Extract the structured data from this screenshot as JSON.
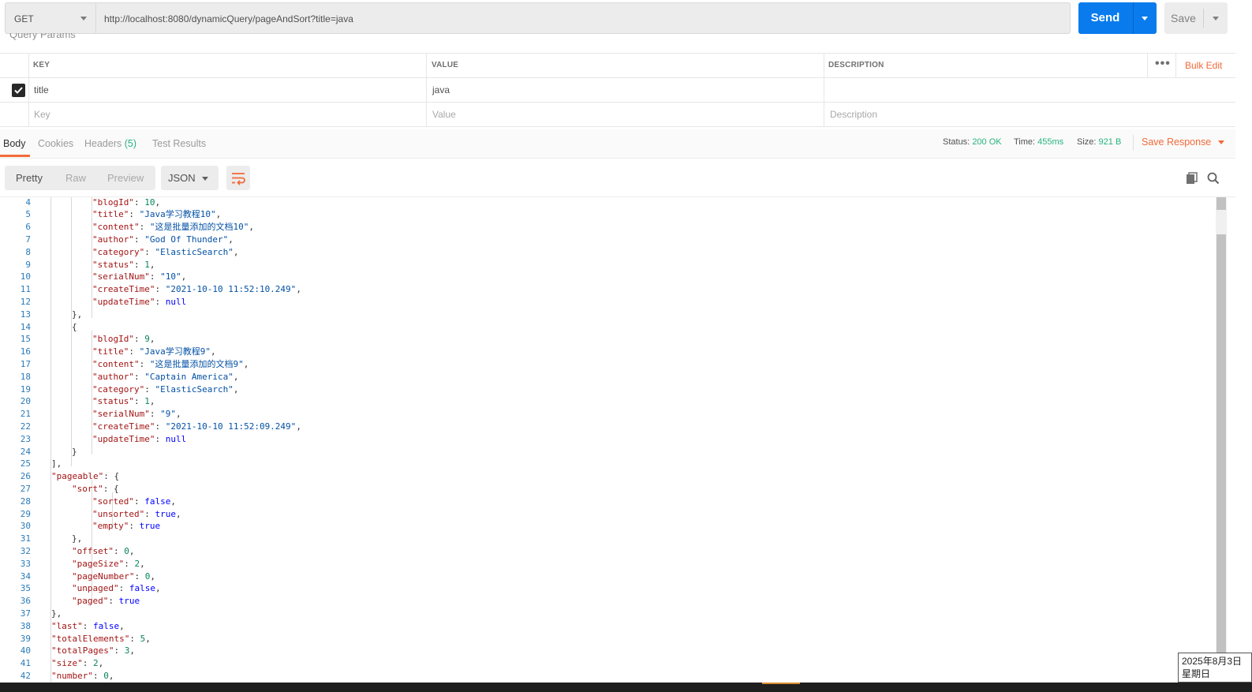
{
  "request": {
    "method": "GET",
    "url": "http://localhost:8080/dynamicQuery/pageAndSort?title=java",
    "send_label": "Send",
    "save_label": "Save"
  },
  "query_params": {
    "section_title": "Query Params",
    "headers": {
      "key": "KEY",
      "value": "VALUE",
      "description": "DESCRIPTION"
    },
    "bulk_edit": "Bulk Edit",
    "more": "•••",
    "rows": [
      {
        "checked": true,
        "key": "title",
        "value": "java",
        "description": ""
      }
    ],
    "placeholders": {
      "key": "Key",
      "value": "Value",
      "description": "Description"
    }
  },
  "response": {
    "tabs": [
      {
        "label": "Body",
        "active": true
      },
      {
        "label": "Cookies",
        "active": false
      },
      {
        "label": "Headers",
        "count": "(5)",
        "active": false
      },
      {
        "label": "Test Results",
        "active": false
      }
    ],
    "status_label": "Status:",
    "status_value": "200 OK",
    "time_label": "Time:",
    "time_value": "455ms",
    "size_label": "Size:",
    "size_value": "921 B",
    "save_response": "Save Response"
  },
  "format": {
    "views": [
      "Pretty",
      "Raw",
      "Preview"
    ],
    "active_view": "Pretty",
    "language": "JSON"
  },
  "code_lines": [
    {
      "n": "4",
      "indent": 3,
      "k": "\"blogId\"",
      "v": "10",
      "vt": "n",
      "end": ","
    },
    {
      "n": "5",
      "indent": 3,
      "k": "\"title\"",
      "v": "\"Java学习教程10\"",
      "vt": "s",
      "end": ","
    },
    {
      "n": "6",
      "indent": 3,
      "k": "\"content\"",
      "v": "\"这是批量添加的文档10\"",
      "vt": "s",
      "end": ","
    },
    {
      "n": "7",
      "indent": 3,
      "k": "\"author\"",
      "v": "\"God Of Thunder\"",
      "vt": "s",
      "end": ","
    },
    {
      "n": "8",
      "indent": 3,
      "k": "\"category\"",
      "v": "\"ElasticSearch\"",
      "vt": "s",
      "end": ","
    },
    {
      "n": "9",
      "indent": 3,
      "k": "\"status\"",
      "v": "1",
      "vt": "n",
      "end": ","
    },
    {
      "n": "10",
      "indent": 3,
      "k": "\"serialNum\"",
      "v": "\"10\"",
      "vt": "s",
      "end": ","
    },
    {
      "n": "11",
      "indent": 3,
      "k": "\"createTime\"",
      "v": "\"2021-10-10 11:52:10.249\"",
      "vt": "s",
      "end": ","
    },
    {
      "n": "12",
      "indent": 3,
      "k": "\"updateTime\"",
      "v": "null",
      "vt": "b",
      "end": ""
    },
    {
      "n": "13",
      "indent": 2,
      "p": "},"
    },
    {
      "n": "14",
      "indent": 2,
      "p": "{"
    },
    {
      "n": "15",
      "indent": 3,
      "k": "\"blogId\"",
      "v": "9",
      "vt": "n",
      "end": ","
    },
    {
      "n": "16",
      "indent": 3,
      "k": "\"title\"",
      "v": "\"Java学习教程9\"",
      "vt": "s",
      "end": ","
    },
    {
      "n": "17",
      "indent": 3,
      "k": "\"content\"",
      "v": "\"这是批量添加的文档9\"",
      "vt": "s",
      "end": ","
    },
    {
      "n": "18",
      "indent": 3,
      "k": "\"author\"",
      "v": "\"Captain America\"",
      "vt": "s",
      "end": ","
    },
    {
      "n": "19",
      "indent": 3,
      "k": "\"category\"",
      "v": "\"ElasticSearch\"",
      "vt": "s",
      "end": ","
    },
    {
      "n": "20",
      "indent": 3,
      "k": "\"status\"",
      "v": "1",
      "vt": "n",
      "end": ","
    },
    {
      "n": "21",
      "indent": 3,
      "k": "\"serialNum\"",
      "v": "\"9\"",
      "vt": "s",
      "end": ","
    },
    {
      "n": "22",
      "indent": 3,
      "k": "\"createTime\"",
      "v": "\"2021-10-10 11:52:09.249\"",
      "vt": "s",
      "end": ","
    },
    {
      "n": "23",
      "indent": 3,
      "k": "\"updateTime\"",
      "v": "null",
      "vt": "b",
      "end": ""
    },
    {
      "n": "24",
      "indent": 2,
      "p": "}"
    },
    {
      "n": "25",
      "indent": 1,
      "p": "],"
    },
    {
      "n": "26",
      "indent": 1,
      "k": "\"pageable\"",
      "p": "{"
    },
    {
      "n": "27",
      "indent": 2,
      "k": "\"sort\"",
      "p": "{"
    },
    {
      "n": "28",
      "indent": 3,
      "k": "\"sorted\"",
      "v": "false",
      "vt": "b",
      "end": ","
    },
    {
      "n": "29",
      "indent": 3,
      "k": "\"unsorted\"",
      "v": "true",
      "vt": "b",
      "end": ","
    },
    {
      "n": "30",
      "indent": 3,
      "k": "\"empty\"",
      "v": "true",
      "vt": "b",
      "end": ""
    },
    {
      "n": "31",
      "indent": 2,
      "p": "},"
    },
    {
      "n": "32",
      "indent": 2,
      "k": "\"offset\"",
      "v": "0",
      "vt": "n",
      "end": ","
    },
    {
      "n": "33",
      "indent": 2,
      "k": "\"pageSize\"",
      "v": "2",
      "vt": "n",
      "end": ","
    },
    {
      "n": "34",
      "indent": 2,
      "k": "\"pageNumber\"",
      "v": "0",
      "vt": "n",
      "end": ","
    },
    {
      "n": "35",
      "indent": 2,
      "k": "\"unpaged\"",
      "v": "false",
      "vt": "b",
      "end": ","
    },
    {
      "n": "36",
      "indent": 2,
      "k": "\"paged\"",
      "v": "true",
      "vt": "b",
      "end": ""
    },
    {
      "n": "37",
      "indent": 1,
      "p": "},"
    },
    {
      "n": "38",
      "indent": 1,
      "k": "\"last\"",
      "v": "false",
      "vt": "b",
      "end": ","
    },
    {
      "n": "39",
      "indent": 1,
      "k": "\"totalElements\"",
      "v": "5",
      "vt": "n",
      "end": ","
    },
    {
      "n": "40",
      "indent": 1,
      "k": "\"totalPages\"",
      "v": "3",
      "vt": "n",
      "end": ","
    },
    {
      "n": "41",
      "indent": 1,
      "k": "\"size\"",
      "v": "2",
      "vt": "n",
      "end": ","
    },
    {
      "n": "42",
      "indent": 1,
      "k": "\"number\"",
      "v": "0",
      "vt": "n",
      "end": ","
    }
  ],
  "clock": {
    "date": "2025年8月3日",
    "weekday": "星期日"
  },
  "icons": {
    "checkbox": "checkmark-icon",
    "wrap": "wrap-lines-icon",
    "copy": "copy-icon",
    "search": "search-icon"
  },
  "colors": {
    "send": "#097bed",
    "accent": "#f26b3a",
    "success": "#26b47f"
  }
}
